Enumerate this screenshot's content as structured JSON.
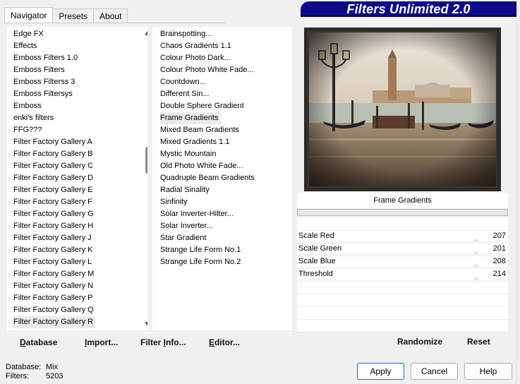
{
  "tabs": [
    {
      "label": "Navigator",
      "active": true
    },
    {
      "label": "Presets",
      "active": false
    },
    {
      "label": "About",
      "active": false
    }
  ],
  "banner": {
    "title": "Filters Unlimited 2.0"
  },
  "categories": {
    "items": [
      "Edge FX",
      "Effects",
      "Emboss Filters 1.0",
      "Emboss Filters",
      "Emboss Filterss 3",
      "Emboss Filtersys",
      "Emboss",
      "enki's filters",
      "FFG???",
      "Filter Factory Gallery A",
      "Filter Factory Gallery B",
      "Filter Factory Gallery C",
      "Filter Factory Gallery D",
      "Filter Factory Gallery E",
      "Filter Factory Gallery F",
      "Filter Factory Gallery G",
      "Filter Factory Gallery H",
      "Filter Factory Gallery J",
      "Filter Factory Gallery K",
      "Filter Factory Gallery L",
      "Filter Factory Gallery M",
      "Filter Factory Gallery N",
      "Filter Factory Gallery P",
      "Filter Factory Gallery Q",
      "Filter Factory Gallery R"
    ],
    "selected_index": 24,
    "scroll_position": 0.43
  },
  "filters": {
    "items": [
      "Brainspotting...",
      "Chaos Gradients 1.1",
      "Colour Photo Dark...",
      "Colour Photo White Fade...",
      "Countdown...",
      "Different Sin...",
      "Double Sphere Gradient",
      "Frame Gradients",
      "Mixed Beam Gradients",
      "Mixed Gradients 1.1",
      "Mystic Mountain",
      "Old Photo White Fade...",
      "Quadruple Beam Gradients",
      "Radial Sinality",
      "Sinfinity",
      "Solar Inverter-Hilter...",
      "Solar Inverter...",
      "Star Gradient",
      "Strange Life Form No.1",
      "Strange Life Form No.2"
    ],
    "selected_index": 7
  },
  "preview": {
    "filter_name": "Frame Gradients"
  },
  "params": [
    {
      "label": "Scale Red",
      "value": "207"
    },
    {
      "label": "Scale Green",
      "value": "201"
    },
    {
      "label": "Scale Blue",
      "value": "208"
    },
    {
      "label": "Threshold",
      "value": "214"
    }
  ],
  "left_buttons": {
    "database": {
      "underlined": "D",
      "rest": "atabase"
    },
    "import": {
      "underlined": "I",
      "rest": "mport..."
    },
    "filter_info": {
      "label_pre": "Filter ",
      "underlined": "I",
      "rest": "nfo..."
    },
    "editor": {
      "underlined": "E",
      "rest": "ditor..."
    }
  },
  "right_buttons": {
    "randomize": "Randomize",
    "reset": "Reset"
  },
  "status": {
    "database_key": "Database:",
    "database_value": "Mix",
    "filters_key": "Filters:",
    "filters_value": "5203"
  },
  "dialog_buttons": {
    "apply": "Apply",
    "cancel": "Cancel",
    "help": "Help"
  },
  "colors": {
    "banner_bg": "#0b0b8a",
    "panel_bg": "#ffffff",
    "window_bg": "#f0f0f0"
  }
}
